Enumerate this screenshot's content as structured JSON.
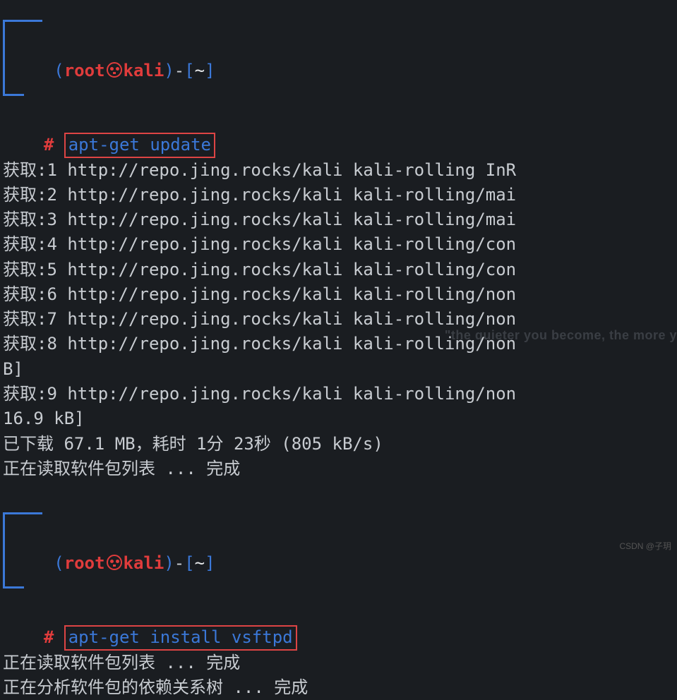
{
  "prompt1": {
    "paren_open": "(",
    "user": "root",
    "host": "kali",
    "paren_close": ")",
    "dash": "-",
    "brk_open": "[",
    "path": "~",
    "brk_close": "]",
    "hash": "#",
    "command": "apt-get update"
  },
  "output1": [
    "获取:1 http://repo.jing.rocks/kali kali-rolling InR",
    "获取:2 http://repo.jing.rocks/kali kali-rolling/mai",
    "获取:3 http://repo.jing.rocks/kali kali-rolling/mai",
    "获取:4 http://repo.jing.rocks/kali kali-rolling/con",
    "获取:5 http://repo.jing.rocks/kali kali-rolling/con",
    "获取:6 http://repo.jing.rocks/kali kali-rolling/non",
    "获取:7 http://repo.jing.rocks/kali kali-rolling/non",
    "获取:8 http://repo.jing.rocks/kali kali-rolling/non",
    "B]",
    "获取:9 http://repo.jing.rocks/kali kali-rolling/non",
    "16.9 kB]",
    "已下载 67.1 MB，耗时 1分 23秒 (805 kB/s)",
    "正在读取软件包列表 ... 完成"
  ],
  "prompt2": {
    "paren_open": "(",
    "user": "root",
    "host": "kali",
    "paren_close": ")",
    "dash": "-",
    "brk_open": "[",
    "path": "~",
    "brk_close": "]",
    "hash": "#",
    "command": "apt-get install vsftpd"
  },
  "output2": [
    "正在读取软件包列表 ... 完成",
    "正在分析软件包的依赖关系树 ... 完成"
  ],
  "watermark_tag": "\"the quieter you become, the more y",
  "csdn": "CSDN @子玥"
}
